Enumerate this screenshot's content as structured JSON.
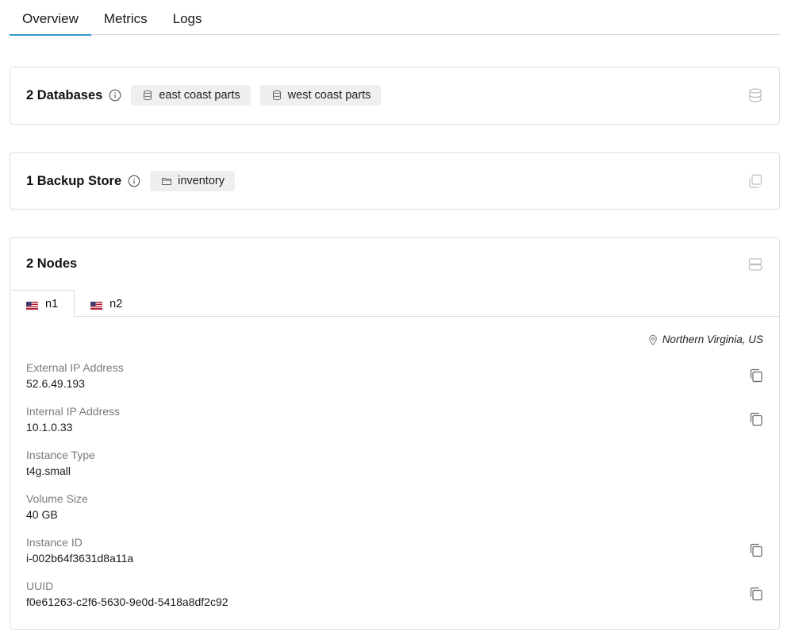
{
  "tabs": [
    {
      "label": "Overview",
      "active": true
    },
    {
      "label": "Metrics",
      "active": false
    },
    {
      "label": "Logs",
      "active": false
    }
  ],
  "databases": {
    "title": "2 Databases",
    "info_icon": "info-icon",
    "items": [
      "east coast parts",
      "west coast parts"
    ],
    "item_icon": "database-icon",
    "card_icon": "database-icon"
  },
  "backup": {
    "title": "1 Backup Store",
    "info_icon": "info-icon",
    "items": [
      "inventory"
    ],
    "item_icon": "folder-icon",
    "card_icon": "copy-stack-icon"
  },
  "nodes": {
    "title": "2 Nodes",
    "card_icon": "server-icon",
    "tabs": [
      {
        "label": "n1",
        "flag": "us-flag",
        "active": true
      },
      {
        "label": "n2",
        "flag": "us-flag",
        "active": false
      }
    ],
    "location": "Northern Virginia, US",
    "fields": [
      {
        "label": "External IP Address",
        "value": "52.6.49.193",
        "copyable": true
      },
      {
        "label": "Internal IP Address",
        "value": "10.1.0.33",
        "copyable": true
      },
      {
        "label": "Instance Type",
        "value": "t4g.small",
        "copyable": false
      },
      {
        "label": "Volume Size",
        "value": "40 GB",
        "copyable": false
      },
      {
        "label": "Instance ID",
        "value": "i-002b64f3631d8a11a",
        "copyable": true
      },
      {
        "label": "UUID",
        "value": "f0e61263-c2f6-5630-9e0d-5418a8df2c92",
        "copyable": true
      }
    ]
  },
  "colors": {
    "accent": "#2f9bd0",
    "chip_bg": "#efefef",
    "muted": "#7a7a7a",
    "border": "#dedede"
  }
}
